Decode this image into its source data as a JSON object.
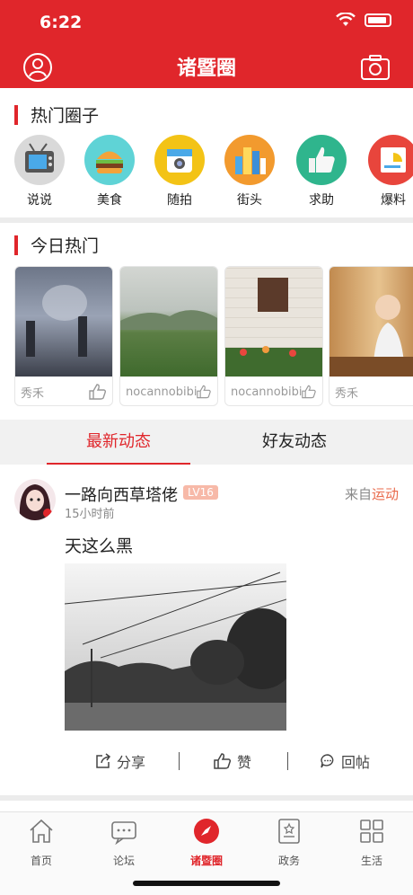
{
  "status_bar": {
    "time": "6:22"
  },
  "header": {
    "title": "诸暨圈"
  },
  "hot_circles": {
    "title": "热门圈子",
    "items": [
      {
        "label": "说说",
        "icon": "tv-icon",
        "color": "#d9d9d9"
      },
      {
        "label": "美食",
        "icon": "burger-icon",
        "color": "#5fd3d6"
      },
      {
        "label": "随拍",
        "icon": "camera-icon",
        "color": "#f3c316"
      },
      {
        "label": "街头",
        "icon": "city-icon",
        "color": "#f29a2e"
      },
      {
        "label": "求助",
        "icon": "thumbs-up-icon",
        "color": "#2fb58d"
      },
      {
        "label": "爆料",
        "icon": "chart-icon",
        "color": "#e8453c"
      }
    ]
  },
  "today_hot": {
    "title": "今日热门",
    "cards": [
      {
        "user": "秀禾"
      },
      {
        "user": "nocannobibi"
      },
      {
        "user": "nocannobibi"
      },
      {
        "user": "秀禾"
      }
    ]
  },
  "tabs": [
    {
      "label": "最新动态",
      "active": true
    },
    {
      "label": "好友动态",
      "active": false
    }
  ],
  "post": {
    "username": "一路向西草塔佬",
    "level": "LV16",
    "time": "15小时前",
    "source_prefix": "来自",
    "source_tag": "运动",
    "text": "天这么黑",
    "actions": {
      "share": "分享",
      "like": "赞",
      "reply": "回帖"
    }
  },
  "bottom_nav": [
    {
      "label": "首页",
      "icon": "home-icon",
      "active": false
    },
    {
      "label": "论坛",
      "icon": "forum-icon",
      "active": false
    },
    {
      "label": "诸暨圈",
      "icon": "compass-icon",
      "active": true
    },
    {
      "label": "政务",
      "icon": "gov-doc-icon",
      "active": false
    },
    {
      "label": "生活",
      "icon": "grid-icon",
      "active": false
    }
  ],
  "colors": {
    "brand_red": "#e0262b",
    "tag_orange": "#e96a4b"
  }
}
